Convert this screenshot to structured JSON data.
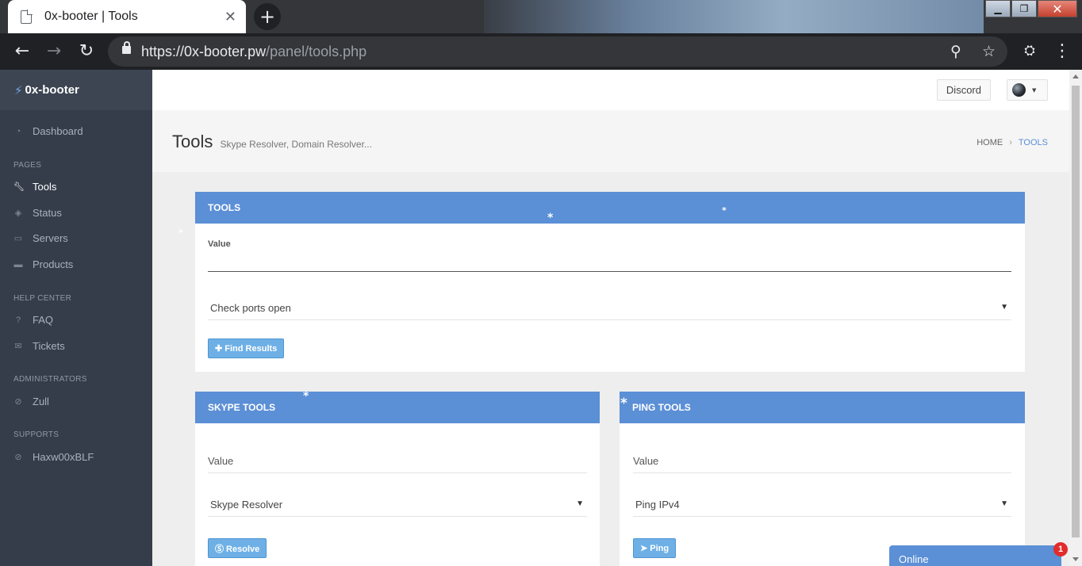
{
  "browser": {
    "tab_title": "0x-booter | Tools",
    "tab_close": "✕",
    "new_tab": "+",
    "url_main": "https://0x-booter.pw",
    "url_path": "/panel/tools.php"
  },
  "sidebar": {
    "brand_icon": "⚡",
    "brand": "0x-booter",
    "dashboard": "Dashboard",
    "sections": {
      "pages": "PAGES",
      "help": "HELP CENTER",
      "admins": "ADMINISTRATORS",
      "supports": "SUPPORTS"
    },
    "pages": [
      "Tools",
      "Status",
      "Servers",
      "Products"
    ],
    "help": [
      "FAQ",
      "Tickets"
    ],
    "admins": [
      "Zull"
    ],
    "supports": [
      "Haxw00xBLF"
    ]
  },
  "topbar": {
    "discord": "Discord"
  },
  "header": {
    "title": "Tools",
    "subtitle": "Skype Resolver, Domain Resolver...",
    "breadcrumb_home": "HOME",
    "breadcrumb_current": "TOOLS"
  },
  "tools_panel": {
    "title": "TOOLS",
    "value_label": "Value",
    "selected": "Check ports open",
    "button": "✚ Find Results"
  },
  "skype_panel": {
    "title": "SKYPE TOOLS",
    "placeholder": "Value",
    "selected": "Skype Resolver",
    "button": "Ⓢ Resolve"
  },
  "ping_panel": {
    "title": "PING TOOLS",
    "placeholder": "Value",
    "selected": "Ping IPv4",
    "button": "➤ Ping"
  },
  "chat": {
    "label": "Online",
    "badge": "1"
  },
  "colors": {
    "accent": "#5b8fd6",
    "sidebar": "#353d4a",
    "button": "#6eb0e6"
  }
}
